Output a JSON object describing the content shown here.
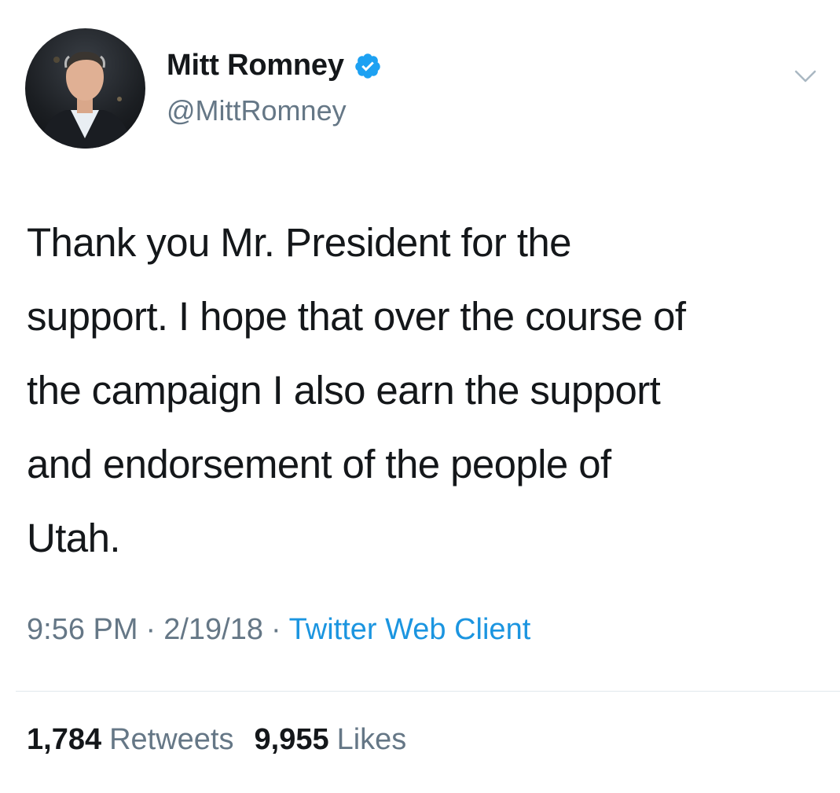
{
  "author": {
    "display_name": "Mitt Romney",
    "handle": "@MittRomney",
    "avatar": "profile-photo",
    "verified": true,
    "verified_icon": "verified-badge-icon"
  },
  "menu_icon": "chevron-down-icon",
  "tweet": {
    "text": "Thank you Mr. President for the\nsupport. I hope that over the course of\nthe campaign I also earn the support\nand endorsement of the people of\nUtah."
  },
  "meta": {
    "time": "9:56 PM",
    "separator": "·",
    "date": "2/19/18",
    "client": "Twitter Web Client"
  },
  "stats": {
    "retweets_count": "1,784",
    "retweets_label": "Retweets",
    "likes_count": "9,955",
    "likes_label": "Likes"
  },
  "colors": {
    "text": "#14171a",
    "secondary": "#657786",
    "link": "#1b95e0",
    "verified": "#1da1f2",
    "divider": "#e1e8ed"
  }
}
